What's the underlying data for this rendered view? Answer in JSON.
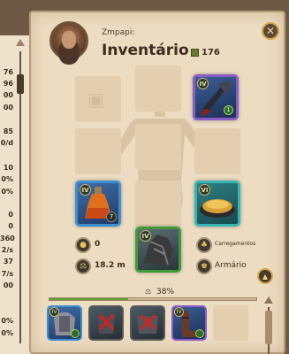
{
  "left_panel": {
    "stats": [
      "76",
      "96",
      "00",
      "00",
      "85",
      "0/d",
      "10",
      "0%",
      "0%",
      "0",
      "0",
      "360",
      "2/s",
      "37",
      "7/s",
      "00",
      "0%",
      "0%"
    ]
  },
  "header": {
    "player_name": "Zmpapi:",
    "title": "Inventário",
    "fame_value": "176"
  },
  "equipment": {
    "weapon_tier": "IV",
    "weapon_quality": "1",
    "potion_tier": "IV",
    "potion_quantity": "7",
    "food_tier": "VI",
    "mount_tier": "IV"
  },
  "stats": {
    "silver": "0",
    "distance": "18.2 m",
    "loadouts_label": "Carregamentos",
    "wardrobe_label": "Armário"
  },
  "weight": {
    "percent_label": "38%",
    "percent": 38
  },
  "bags": [
    {
      "tier": "IV",
      "state": "equipped",
      "quality": "1"
    },
    {
      "tier": "",
      "state": "broken"
    },
    {
      "tier": "",
      "state": "broken"
    },
    {
      "tier": "IV",
      "state": "equipped",
      "quality": "1"
    }
  ],
  "colors": {
    "weapon_border": "#8a5cc8",
    "potion_border": "#3f8fcf",
    "food_border": "#38b5b0",
    "mount_border": "#3f9a3a",
    "weight_fill": "#62a03a"
  }
}
